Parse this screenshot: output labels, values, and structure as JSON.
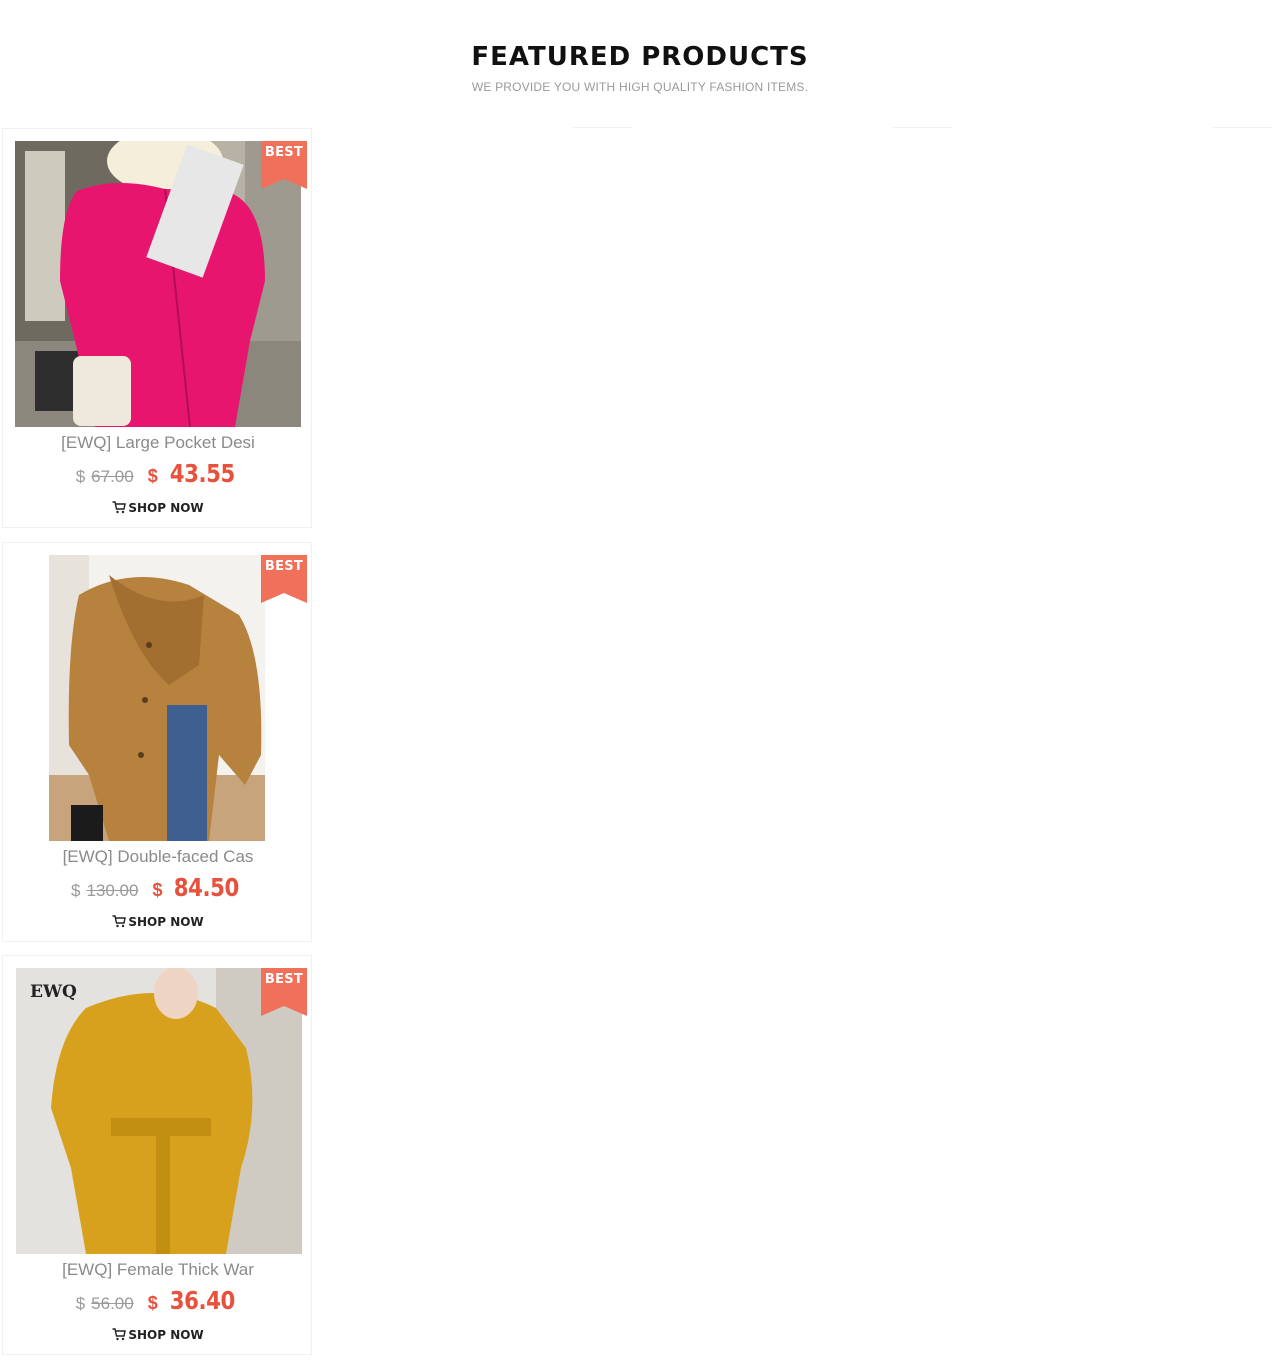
{
  "header": {
    "title": "FEATURED PRODUCTS",
    "subtitle": "WE PROVIDE YOU WITH HIGH QUALITY FASHION ITEMS."
  },
  "products": [
    {
      "name": "[EWQ] Large Pocket Desi",
      "currency": "$",
      "old_price": "67.00",
      "new_price": "43.55",
      "badge": "BEST",
      "shop_label": "SHOP NOW",
      "coat_color": "#e8156e"
    },
    {
      "name": "[EWQ] Double-faced Cas",
      "currency": "$",
      "old_price": "130.00",
      "new_price": "84.50",
      "badge": "BEST",
      "shop_label": "SHOP NOW",
      "coat_color": "#b7813e"
    },
    {
      "name": "[EWQ] Female Thick War",
      "currency": "$",
      "old_price": "56.00",
      "new_price": "36.40",
      "badge": "BEST",
      "shop_label": "SHOP NOW",
      "coat_color": "#d8a11d",
      "logo": "EWQ"
    }
  ],
  "colors": {
    "accent": "#e8513c",
    "badge": "#f0705a"
  },
  "icons": {
    "cart": "shopping-cart-icon"
  }
}
